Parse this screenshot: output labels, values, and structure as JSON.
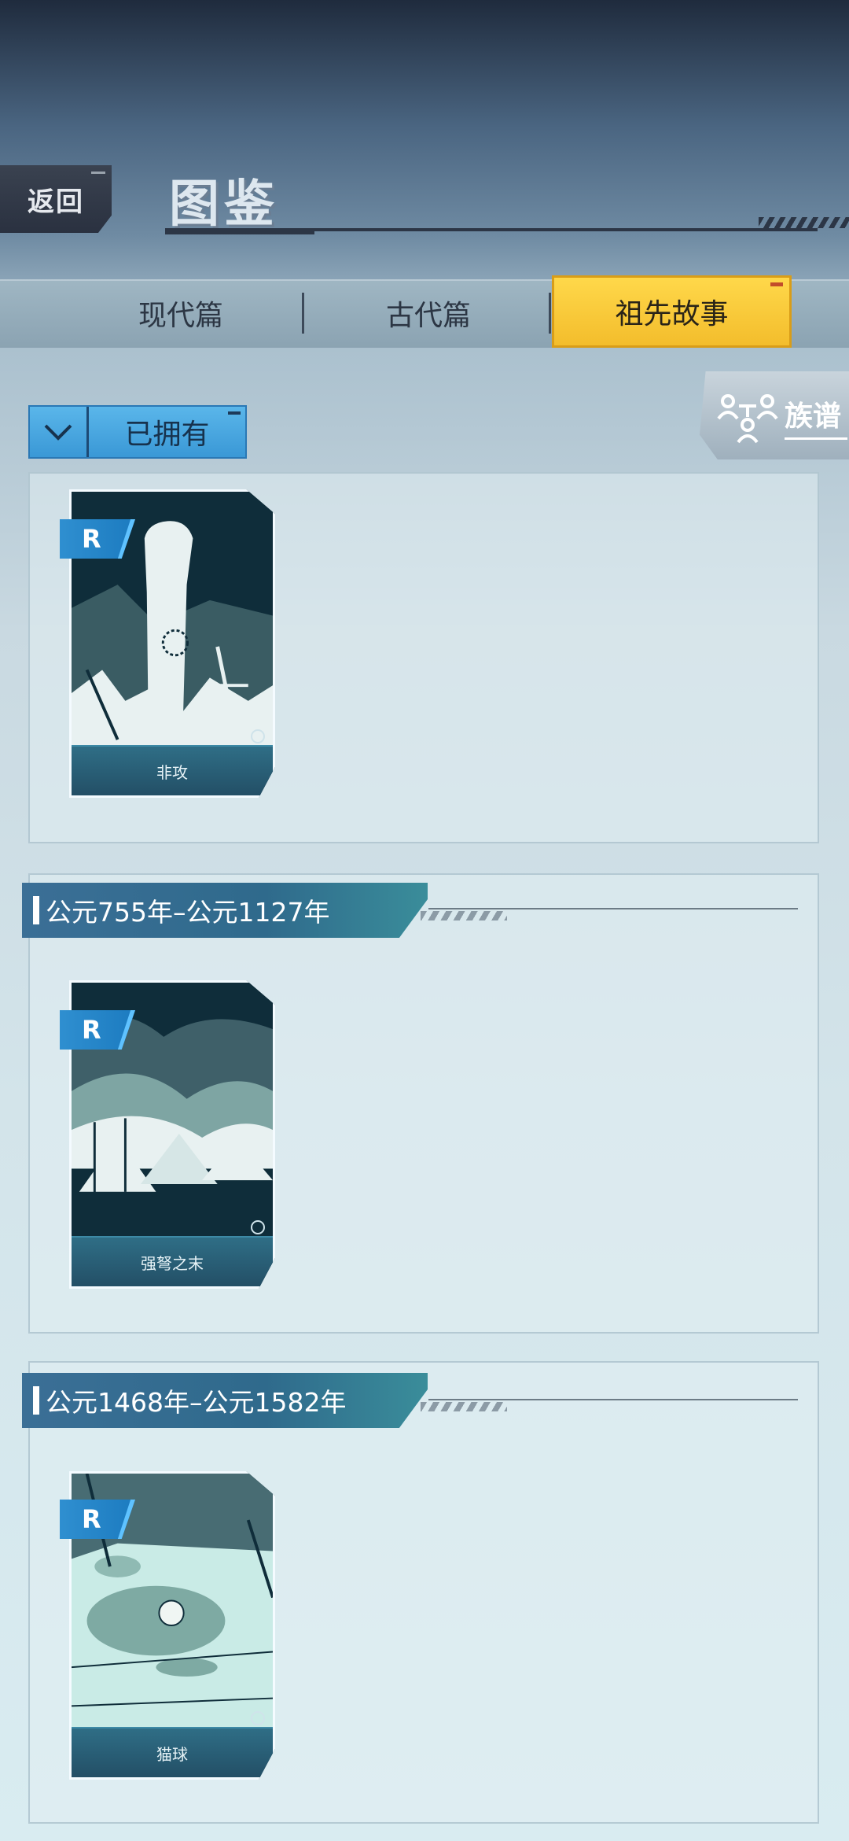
{
  "header": {
    "back_label": "返回",
    "title": "图鉴"
  },
  "tabs": [
    {
      "label": "现代篇",
      "active": false
    },
    {
      "label": "古代篇",
      "active": false
    },
    {
      "label": "祖先故事",
      "active": true
    }
  ],
  "filter": {
    "selected": "已拥有",
    "icon": "chevron-down-icon"
  },
  "family_tree": {
    "label": "族谱",
    "icon": "family-tree-icon"
  },
  "sections": [
    {
      "era": "",
      "cards": [
        {
          "rarity": "R",
          "name": "非攻",
          "art": "raised-fist-battlefield"
        }
      ]
    },
    {
      "era": "公元755年–公元1127年",
      "cards": [
        {
          "rarity": "R",
          "name": "强弩之末",
          "art": "army-tents-banners"
        }
      ]
    },
    {
      "era": "公元1468年–公元1582年",
      "cards": [
        {
          "rarity": "R",
          "name": "猫球",
          "art": "ball-on-tiled-floor"
        }
      ]
    }
  ],
  "colors": {
    "active_tab": "#f7c935",
    "filter_bg": "#3a98d6",
    "era_header": "#2f6a8c",
    "card_name_bar": "#234f66"
  }
}
